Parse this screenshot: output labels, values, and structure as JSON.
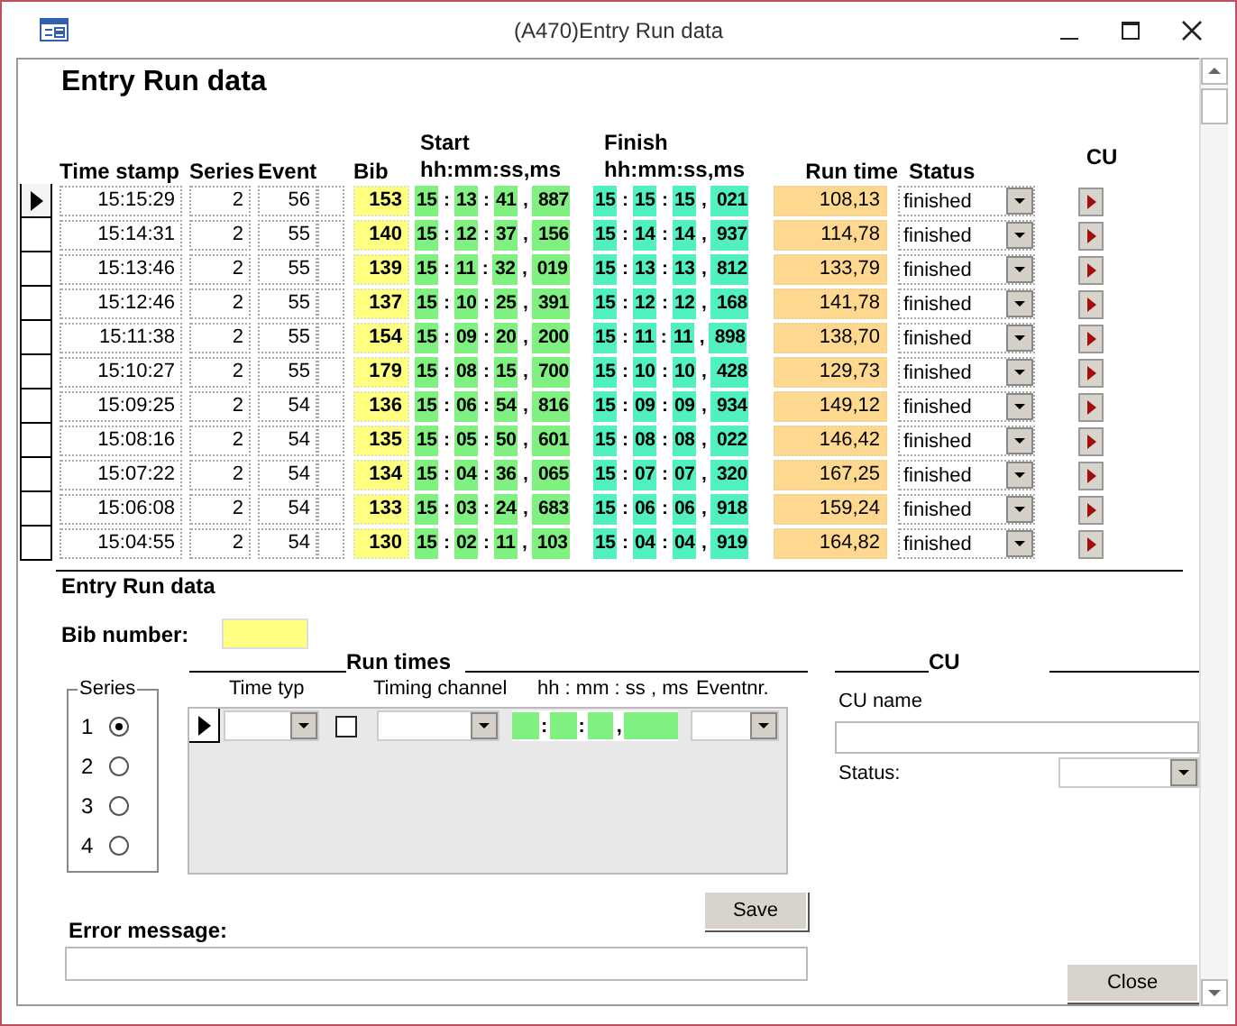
{
  "window": {
    "title": "(A470)Entry Run data"
  },
  "heading": "Entry Run data",
  "columns": {
    "time_stamp": "Time stamp",
    "series": "Series",
    "event": "Event",
    "bib": "Bib",
    "start": [
      "Start",
      "hh:mm:ss,ms"
    ],
    "finish": [
      "Finish",
      "hh:mm:ss,ms"
    ],
    "run_time": "Run time",
    "status": "Status",
    "cu": "CU"
  },
  "rows": [
    {
      "current": true,
      "time_stamp": "15:15:29",
      "series": "2",
      "event": "56",
      "bib": "153",
      "start": "15 : 13 : 41 , 887",
      "finish": "15 : 15 : 15 , 021",
      "run_time": "108,13",
      "status": "finished"
    },
    {
      "current": false,
      "time_stamp": "15:14:31",
      "series": "2",
      "event": "55",
      "bib": "140",
      "start": "15 : 12 : 37 , 156",
      "finish": "15 : 14 : 14 , 937",
      "run_time": "114,78",
      "status": "finished"
    },
    {
      "current": false,
      "time_stamp": "15:13:46",
      "series": "2",
      "event": "55",
      "bib": "139",
      "start": "15 : 11 : 32 , 019",
      "finish": "15 : 13 : 13 , 812",
      "run_time": "133,79",
      "status": "finished"
    },
    {
      "current": false,
      "time_stamp": "15:12:46",
      "series": "2",
      "event": "55",
      "bib": "137",
      "start": "15 : 10 : 25 , 391",
      "finish": "15 : 12 : 12 , 168",
      "run_time": "141,78",
      "status": "finished"
    },
    {
      "current": false,
      "time_stamp": "15:11:38",
      "series": "2",
      "event": "55",
      "bib": "154",
      "start": "15 : 09 : 20 , 200",
      "finish": "15 : 11 : 11 , 898",
      "run_time": "138,70",
      "status": "finished"
    },
    {
      "current": false,
      "time_stamp": "15:10:27",
      "series": "2",
      "event": "55",
      "bib": "179",
      "start": "15 : 08 : 15 , 700",
      "finish": "15 : 10 : 10 , 428",
      "run_time": "129,73",
      "status": "finished"
    },
    {
      "current": false,
      "time_stamp": "15:09:25",
      "series": "2",
      "event": "54",
      "bib": "136",
      "start": "15 : 06 : 54 , 816",
      "finish": "15 : 09 : 09 , 934",
      "run_time": "149,12",
      "status": "finished"
    },
    {
      "current": false,
      "time_stamp": "15:08:16",
      "series": "2",
      "event": "54",
      "bib": "135",
      "start": "15 : 05 : 50 , 601",
      "finish": "15 : 08 : 08 , 022",
      "run_time": "146,42",
      "status": "finished"
    },
    {
      "current": false,
      "time_stamp": "15:07:22",
      "series": "2",
      "event": "54",
      "bib": "134",
      "start": "15 : 04 : 36 , 065",
      "finish": "15 : 07 : 07 , 320",
      "run_time": "167,25",
      "status": "finished"
    },
    {
      "current": false,
      "time_stamp": "15:06:08",
      "series": "2",
      "event": "54",
      "bib": "133",
      "start": "15 : 03 : 24 , 683",
      "finish": "15 : 06 : 06 , 918",
      "run_time": "159,24",
      "status": "finished"
    },
    {
      "current": false,
      "time_stamp": "15:04:55",
      "series": "2",
      "event": "54",
      "bib": "130",
      "start": "15 : 02 : 11 , 103",
      "finish": "15 : 04 : 04 , 919",
      "run_time": "164,82",
      "status": "finished"
    }
  ],
  "entry": {
    "title": "Entry Run data",
    "bib_label": "Bib number:",
    "run_times": {
      "title": "Run times",
      "columns": [
        "Time typ",
        "Timing channel",
        "hh : mm : ss ,  ms",
        "Eventnr."
      ],
      "time_separators": [
        ":",
        ":",
        ","
      ],
      "current": true,
      "checked": false
    },
    "series": {
      "label": "Series",
      "options": [
        {
          "label": "1",
          "selected": true
        },
        {
          "label": "2",
          "selected": false
        },
        {
          "label": "3",
          "selected": false
        },
        {
          "label": "4",
          "selected": false
        }
      ]
    },
    "cu": {
      "title": "CU",
      "name_label": "CU name",
      "status_label": "Status:"
    },
    "error_label": "Error message:",
    "save": "Save",
    "close": "Close"
  }
}
